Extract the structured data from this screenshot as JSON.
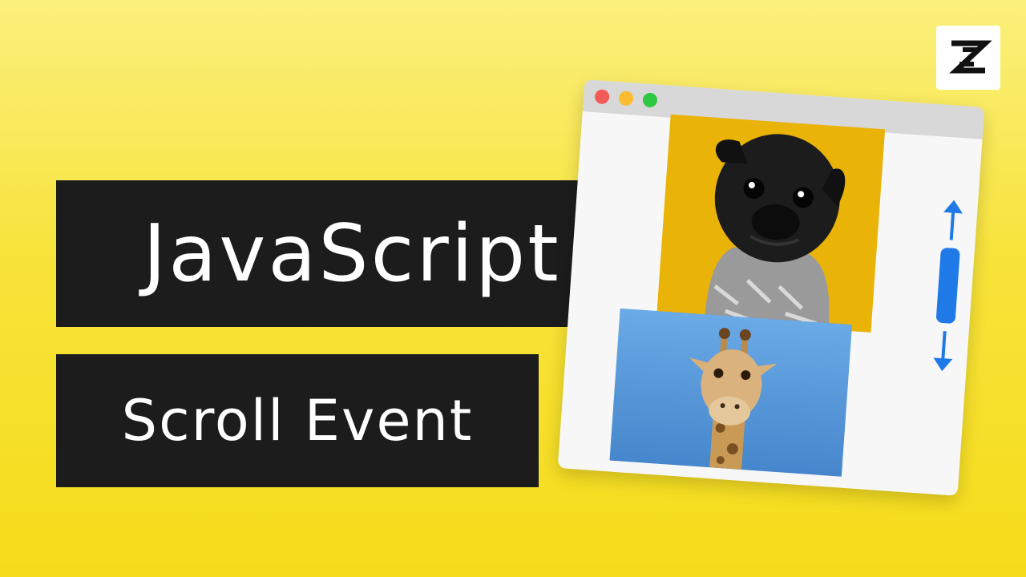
{
  "title": "JavaScript",
  "subtitle": "Scroll Event",
  "logo": {
    "icon": "z-logo-icon"
  },
  "browser": {
    "traffic_lights": [
      "#f25a56",
      "#fbbd2e",
      "#2ec842"
    ],
    "images": [
      {
        "icon": "pug-photo",
        "background": "#eab308"
      },
      {
        "icon": "giraffe-photo",
        "background": "#4a8ad0"
      }
    ],
    "scroll_indicator": {
      "color": "#1f7ae8",
      "up_icon": "arrow-up-icon",
      "down_icon": "arrow-down-icon"
    }
  },
  "colors": {
    "background_top": "#fbf07d",
    "background_bottom": "#f5dc1a",
    "label_box": "#1c1c1c",
    "label_text": "#ffffff"
  }
}
